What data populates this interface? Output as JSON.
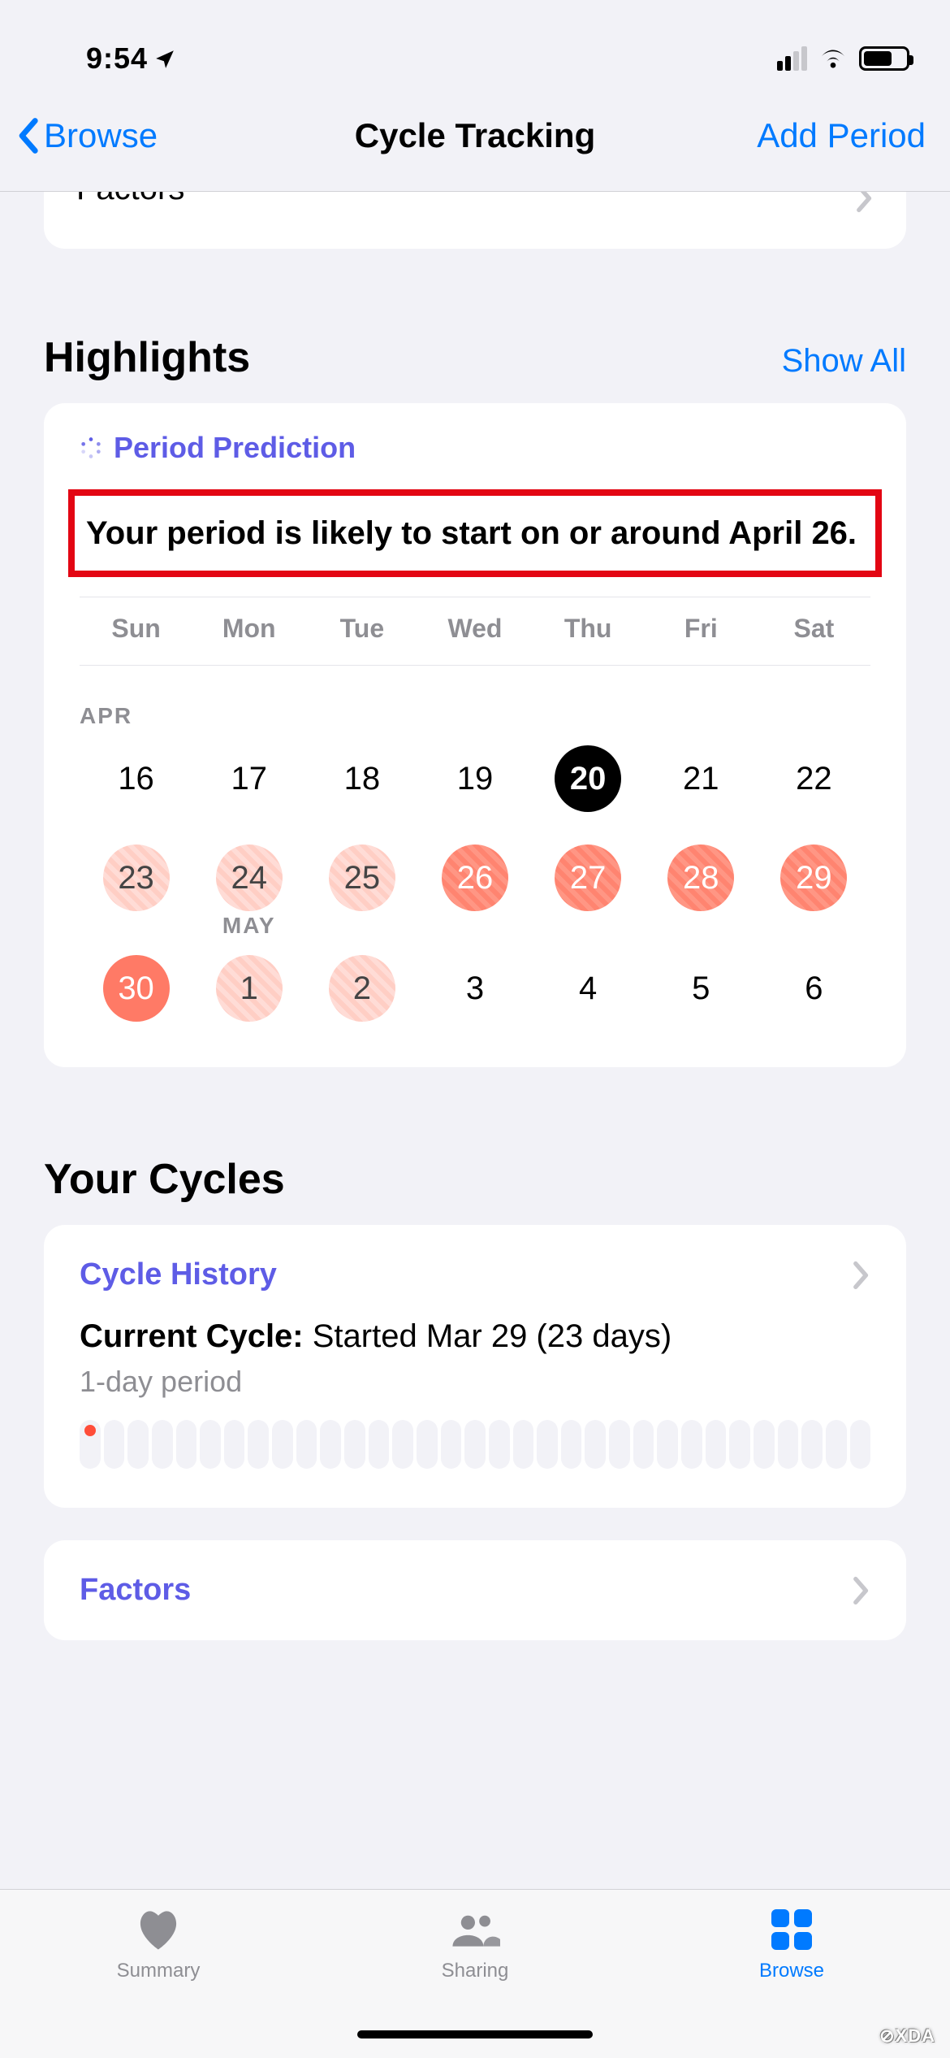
{
  "status": {
    "time": "9:54"
  },
  "nav": {
    "back": "Browse",
    "title": "Cycle Tracking",
    "right": "Add Period"
  },
  "cut_card": {
    "label": "Factors"
  },
  "highlights": {
    "title": "Highlights",
    "link": "Show All",
    "pred_label": "Period Prediction",
    "pred_text": "Your period is likely to start on or around April 26.",
    "weekdays": [
      "Sun",
      "Mon",
      "Tue",
      "Wed",
      "Thu",
      "Fri",
      "Sat"
    ],
    "month1": "APR",
    "month2": "MAY",
    "row1": [
      "16",
      "17",
      "18",
      "19",
      "20",
      "21",
      "22"
    ],
    "row2": [
      "23",
      "24",
      "25",
      "26",
      "27",
      "28",
      "29"
    ],
    "row3": [
      "30",
      "1",
      "2",
      "3",
      "4",
      "5",
      "6"
    ]
  },
  "cycles": {
    "title": "Your Cycles",
    "history_label": "Cycle History",
    "current_label": "Current Cycle:",
    "current_value": " Started Mar 29 (23 days)",
    "sub": "1-day period",
    "factors_label": "Factors"
  },
  "tabs": {
    "summary": "Summary",
    "sharing": "Sharing",
    "browse": "Browse"
  },
  "watermark": "⊘XDA"
}
